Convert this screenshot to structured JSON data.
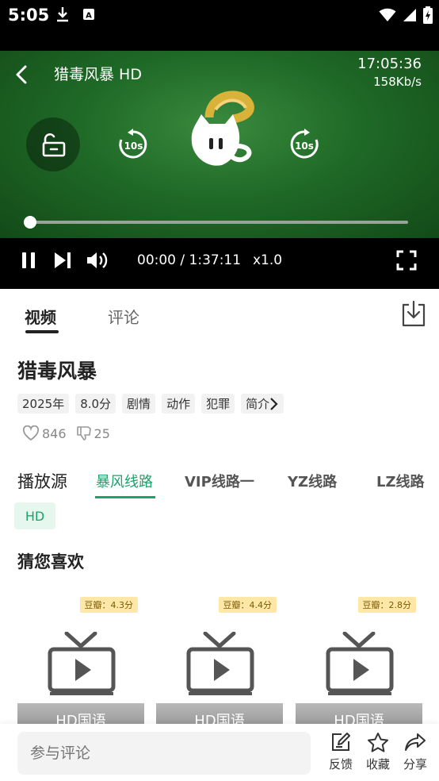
{
  "status_bar": {
    "time": "5:05"
  },
  "player": {
    "title": "猎毒风暴 HD",
    "clock": "17:05:36",
    "net_speed": "158Kb/s",
    "rewind_label": "10s",
    "forward_label": "10s",
    "progress": 0.0,
    "timecode": "00:00 / 1:37:11",
    "rate": "x1.0"
  },
  "tabs": {
    "video": "视频",
    "comments": "评论"
  },
  "movie": {
    "title": "猎毒风暴",
    "tags": [
      "2025年",
      "8.0分",
      "剧情",
      "动作",
      "犯罪"
    ],
    "intro_label": "简介",
    "likes": "846",
    "dislikes": "25"
  },
  "sources": {
    "label": "播放源",
    "items": [
      "暴风线路",
      "VIP线路一",
      "YZ线路",
      "LZ线路"
    ],
    "selected": "暴风线路",
    "quality": "HD"
  },
  "recommend": {
    "title": "猜您喜欢",
    "cards": [
      {
        "score": "豆瓣：4.3分",
        "caption": "HD国语"
      },
      {
        "score": "豆瓣：4.4分",
        "caption": "HD国语"
      },
      {
        "score": "豆瓣：2.8分",
        "caption": "HD国语"
      }
    ]
  },
  "bottom": {
    "comment_placeholder": "参与评论",
    "feedback": "反馈",
    "favorite": "收藏",
    "share": "分享"
  },
  "colors": {
    "accent": "#1aa36b",
    "player_bg": "#1f6a27"
  }
}
